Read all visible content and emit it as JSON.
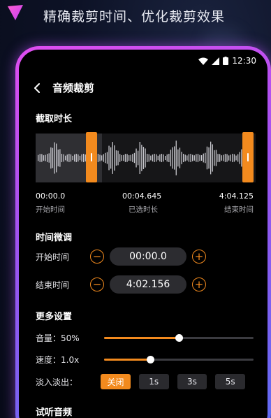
{
  "promo": {
    "tagline": "精确裁剪时间、优化裁剪效果"
  },
  "status_bar": {
    "time": "12:30",
    "icons": [
      "wifi-icon",
      "cellular-signal-icon",
      "battery-icon"
    ]
  },
  "header": {
    "back_icon": "chevron-left-icon",
    "title": "音频裁剪"
  },
  "capture": {
    "section_title": "截取时长",
    "start_time": "00:00.0",
    "start_label": "开始时间",
    "selected_duration": "00:04.645",
    "selected_label": "已选时长",
    "end_time": "4:04.125",
    "end_label": "结束时间"
  },
  "fine_tune": {
    "section_title": "时间微调",
    "start": {
      "label": "开始时间",
      "value": "00:00.0"
    },
    "end": {
      "label": "结束时间",
      "value": "4:02.156"
    },
    "decrement_symbol": "−",
    "increment_symbol": "+"
  },
  "more_settings": {
    "section_title": "更多设置",
    "volume": {
      "label": "音量：50%",
      "level": 0.5
    },
    "speed": {
      "label": "速度：1.0x",
      "level": 0.31
    },
    "fade": {
      "label": "淡入淡出：",
      "options": [
        "关闭",
        "1s",
        "3s",
        "5s"
      ],
      "selected_index": 0
    }
  },
  "preview": {
    "section_title": "试听音频"
  },
  "colors": {
    "accent": "#f28a1e",
    "frame_gradient_start": "#e04df0",
    "frame_gradient_end": "#5d6cf2",
    "screen_bg": "#000000"
  }
}
